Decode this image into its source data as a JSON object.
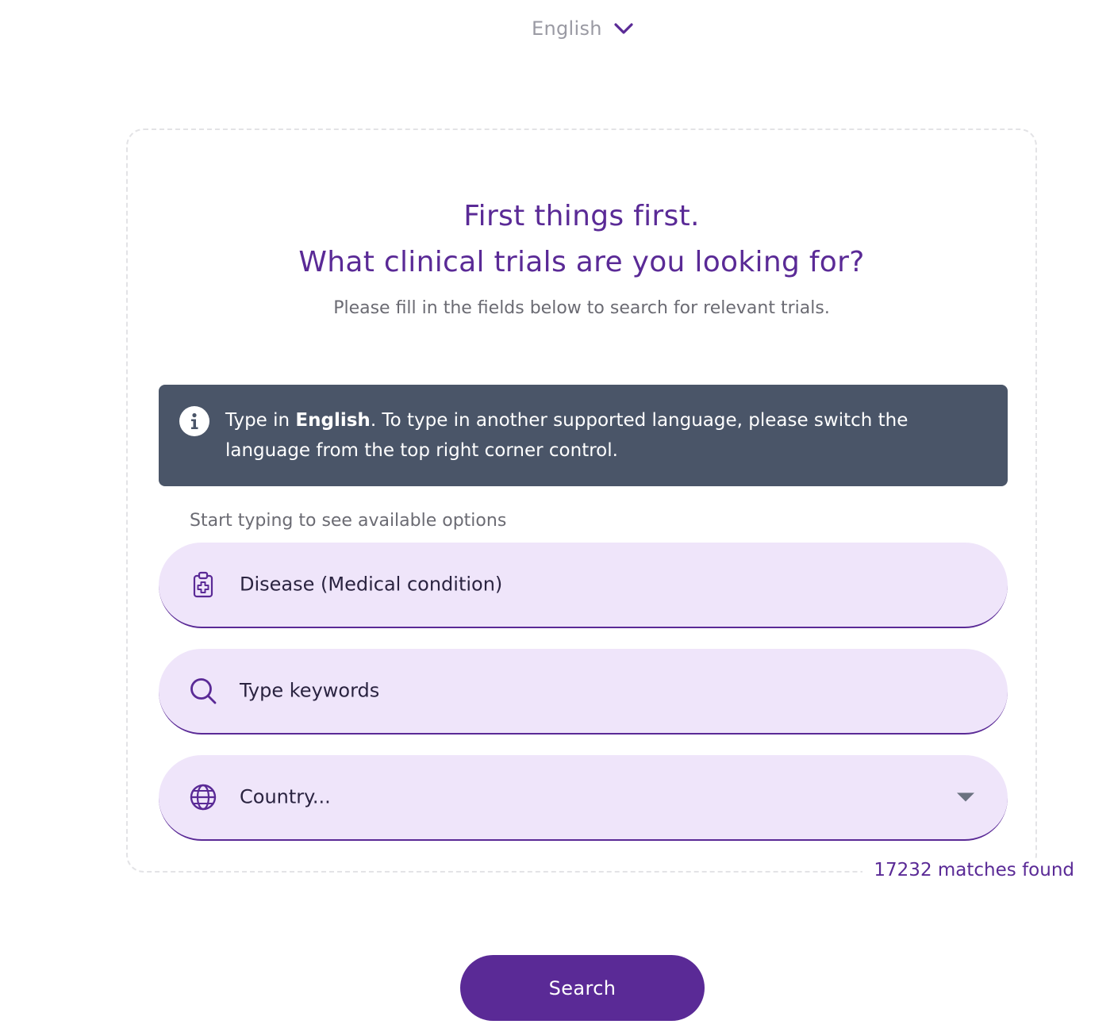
{
  "language_selector": {
    "label": "English"
  },
  "heading": {
    "line1": "First things first.",
    "line2": "What clinical trials are you looking for?",
    "subtitle": "Please fill in the fields below to search for relevant trials."
  },
  "info_banner": {
    "prefix": "Type in ",
    "language": "English",
    "suffix": ". To type in another supported language, please switch the language from the top right corner control."
  },
  "hint": "Start typing to see available options",
  "fields": {
    "disease": {
      "placeholder": "Disease (Medical condition)",
      "icon": "clipboard-medical-icon"
    },
    "keywords": {
      "placeholder": "Type keywords",
      "icon": "search-icon"
    },
    "country": {
      "placeholder": "Country...",
      "icon": "globe-icon"
    }
  },
  "matches_text": "17232 matches found",
  "search_button": "Search",
  "colors": {
    "primary": "#5a2a96",
    "field_bg": "#efe5fa",
    "banner_bg": "#4a5568"
  }
}
